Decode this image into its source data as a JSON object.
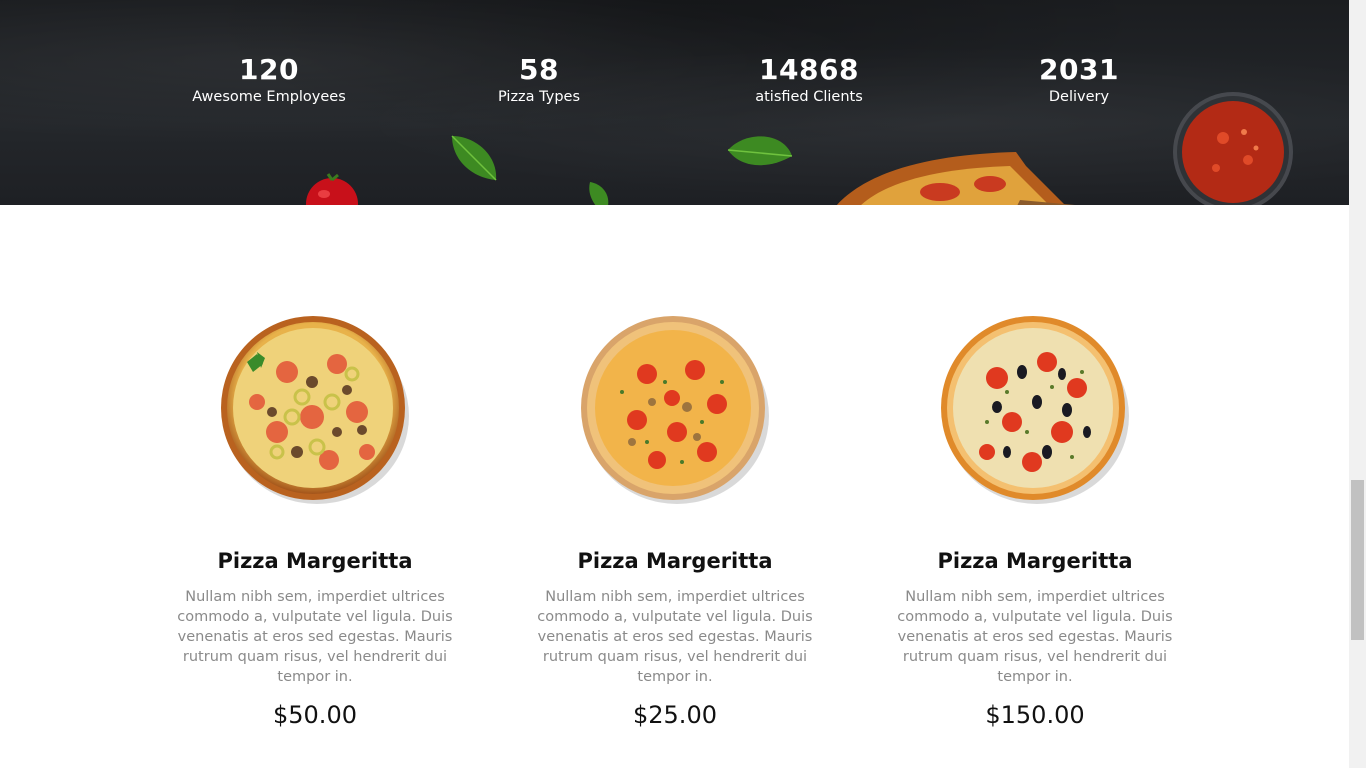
{
  "stats": [
    {
      "number": "120",
      "label": "Awesome Employees"
    },
    {
      "number": "58",
      "label": "Pizza Types"
    },
    {
      "number": "14868",
      "label": "atisfied Clients"
    },
    {
      "number": "2031",
      "label": "Delivery"
    }
  ],
  "menu": [
    {
      "title": "Pizza Margeritta",
      "description": "Nullam nibh sem, imperdiet ultrices commodo a, vulputate vel ligula. Duis venenatis at eros sed egestas. Mauris rutrum quam risus, vel hendrerit dui tempor in.",
      "price": "$50.00"
    },
    {
      "title": "Pizza Margeritta",
      "description": "Nullam nibh sem, imperdiet ultrices commodo a, vulputate vel ligula. Duis venenatis at eros sed egestas. Mauris rutrum quam risus, vel hendrerit dui tempor in.",
      "price": "$25.00"
    },
    {
      "title": "Pizza Margeritta",
      "description": "Nullam nibh sem, imperdiet ultrices commodo a, vulputate vel ligula. Duis venenatis at eros sed egestas. Mauris rutrum quam risus, vel hendrerit dui tempor in.",
      "price": "$150.00"
    }
  ],
  "colors": {
    "band_background": "#1e2024",
    "text_light": "#ffffff",
    "title_dark": "#111111",
    "description_gray": "#8a8a8a"
  },
  "icons": [
    "tomato-decoration",
    "basil-leaf-decoration",
    "pizza-slice-decoration",
    "tomato-sauce-bowl-decoration",
    "pizza-image"
  ]
}
